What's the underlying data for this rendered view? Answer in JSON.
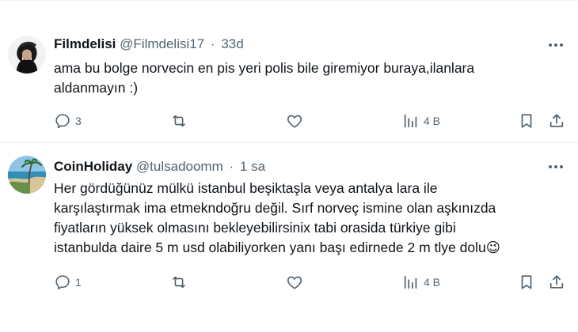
{
  "tweets": [
    {
      "name": "Filmdelisi",
      "handle": "@Filmdelisi17",
      "separator": "·",
      "time": "33d",
      "text_lines": [
        "ama bu bolge norvecin en pis yeri polis bile giremiyor buraya,ilanlara",
        "aldanmayın :)"
      ],
      "reply_count": "3",
      "retweet_count": "",
      "like_count": "",
      "views": "4 B",
      "avatar_icon": "person-with-hat-avatar"
    },
    {
      "name": "CoinHoliday",
      "handle": "@tulsadoomm",
      "separator": "·",
      "time": "1 sa",
      "text_lines": [
        "Her gördüğünüz mülkü istanbul beşiktaşla veya antalya lara ile",
        "karşılaştırmak ima etmekndoğru değil.  Sırf norveç ismine olan aşkınızda",
        "fiyatların yüksek olmasını bekleyebilirsinix tabi orasida türkiye gibi",
        "istanbulda daire 5 m usd olabiliyorken yanı başı edirnede 2 m tlye dolu😉"
      ],
      "reply_count": "1",
      "retweet_count": "",
      "like_count": "",
      "views": "4 B",
      "avatar_icon": "beach-landscape-avatar"
    }
  ],
  "colors": {
    "text": "#0f1419",
    "secondary": "#536471",
    "divider": "#eff3f4"
  }
}
